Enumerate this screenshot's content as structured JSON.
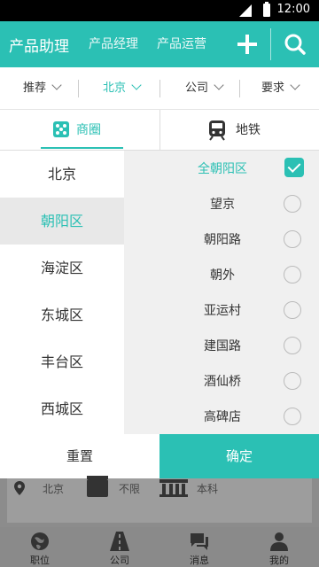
{
  "status_bar": {
    "time": "12:00"
  },
  "app_bar": {
    "tabs": [
      "产品助理",
      "产品经理",
      "产品运营"
    ],
    "colors": {
      "accent": "#2bc0b4"
    }
  },
  "filters": [
    {
      "label": "推荐",
      "active": false
    },
    {
      "label": "北京",
      "active": true
    },
    {
      "label": "公司",
      "active": false
    },
    {
      "label": "要求",
      "active": false
    }
  ],
  "sub_tabs": {
    "business_area": "商圈",
    "metro": "地铁"
  },
  "cities": [
    "北京",
    "朝阳区",
    "海淀区",
    "东城区",
    "丰台区",
    "西城区"
  ],
  "selected_city": "朝阳区",
  "areas": [
    {
      "label": "全朝阳区",
      "checked": true
    },
    {
      "label": "望京",
      "checked": false
    },
    {
      "label": "朝阳路",
      "checked": false
    },
    {
      "label": "朝外",
      "checked": false
    },
    {
      "label": "亚运村",
      "checked": false
    },
    {
      "label": "建国路",
      "checked": false
    },
    {
      "label": "酒仙桥",
      "checked": false
    },
    {
      "label": "高碑店",
      "checked": false
    }
  ],
  "actions": {
    "reset": "重置",
    "confirm": "确定"
  },
  "background_card": {
    "location": "北京",
    "experience": "不限",
    "education": "本科"
  },
  "bottom_tabs": [
    {
      "label": "职位",
      "icon": "globe-icon"
    },
    {
      "label": "公司",
      "icon": "road-icon"
    },
    {
      "label": "消息",
      "icon": "chat-icon"
    },
    {
      "label": "我的",
      "icon": "person-icon"
    }
  ]
}
